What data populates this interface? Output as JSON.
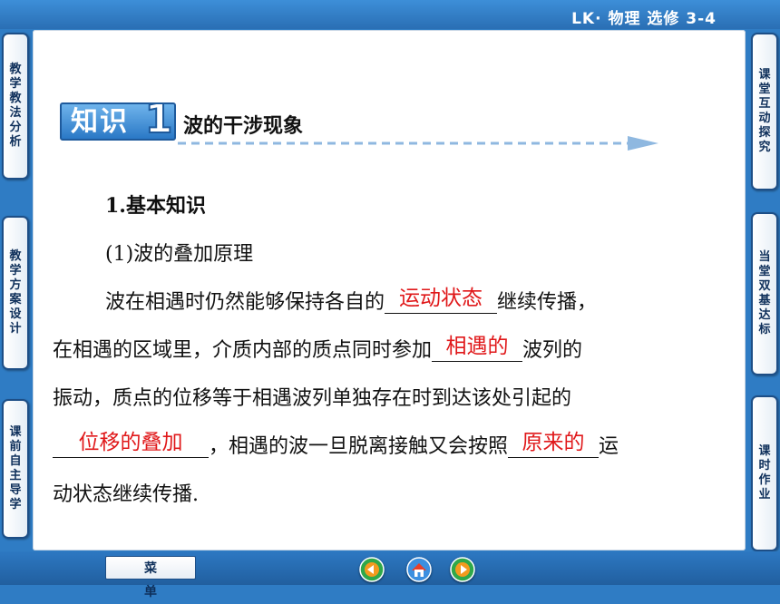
{
  "header": {
    "course_label": "LK· 物理  选修  3-4"
  },
  "left_nav": [
    {
      "label": "教学教法分析"
    },
    {
      "label": "教学方案设计"
    },
    {
      "label": "课前自主导学"
    }
  ],
  "right_nav": [
    {
      "label": "课堂互动探究"
    },
    {
      "label": "当堂双基达标"
    },
    {
      "label": "课时作业"
    }
  ],
  "section": {
    "badge_text": "知识",
    "badge_number": "1",
    "title": "波的干涉现象"
  },
  "body": {
    "heading": "1.基本知识",
    "subheading": "(1)波的叠加原理",
    "line1_a": "波在相遇时仍然能够保持各自的",
    "blank1": "运动状态",
    "line1_b": "继续传播，",
    "line2_a": "在相遇的区域里，介质内部的质点同时参加",
    "blank2": "相遇的",
    "line2_b": "波列的",
    "line3": "振动，质点的位移等于相遇波列单独存在时到达该处引起的",
    "blank3": "位移的叠加",
    "line4_a": "，相遇的波一旦脱离接触又会按照",
    "blank4": "原来的",
    "line4_b": "运",
    "line5": "动状态继续传播."
  },
  "footer": {
    "menu_label": "菜单",
    "nav_icons": [
      "back-icon",
      "home-icon",
      "forward-icon"
    ]
  },
  "colors": {
    "frame": "#2f7cc4",
    "answer": "#e0181a",
    "badge": "#2a78c6"
  }
}
